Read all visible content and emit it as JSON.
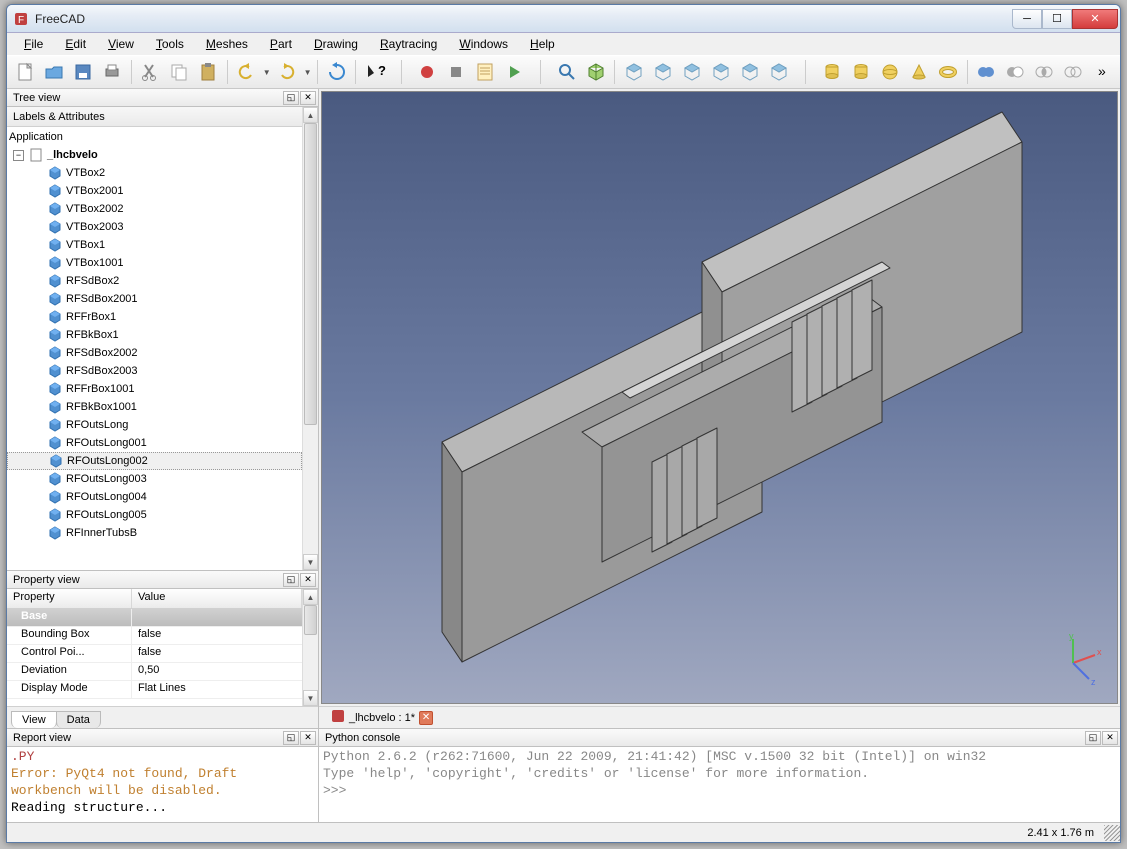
{
  "app_title": "FreeCAD",
  "menubar": [
    "File",
    "Edit",
    "View",
    "Tools",
    "Meshes",
    "Part",
    "Drawing",
    "Raytracing",
    "Windows",
    "Help"
  ],
  "toolbar_icons": [
    "new-doc-icon",
    "open-icon",
    "save-icon",
    "print-icon",
    "sep",
    "cut-icon",
    "copy-icon",
    "paste-icon",
    "sep",
    "undo-icon",
    "dd",
    "redo-icon",
    "dd",
    "sep",
    "refresh-icon",
    "sep",
    "whatsthis-icon",
    "sep2",
    "record-icon",
    "stop-icon",
    "macro-icon",
    "play-icon",
    "sep2",
    "zoom-fit-icon",
    "iso-icon",
    "sep",
    "front-icon",
    "top-icon",
    "right-icon",
    "back-icon",
    "bottom-icon",
    "left-icon",
    "sep2",
    "cylinder-icon",
    "cylinder2-icon",
    "sphere-icon",
    "cone-icon",
    "torus-icon",
    "sep",
    "bool-union-icon",
    "bool-cut-icon",
    "bool-intersect-icon",
    "bool-section-icon",
    "overflow-icon"
  ],
  "tree_panel": {
    "title": "Tree view",
    "subheader": "Labels & Attributes"
  },
  "tree": {
    "root": "Application",
    "doc": "_lhcbvelo",
    "items": [
      "VTBox2",
      "VTBox2001",
      "VTBox2002",
      "VTBox2003",
      "VTBox1",
      "VTBox1001",
      "RFSdBox2",
      "RFSdBox2001",
      "RFFrBox1",
      "RFBkBox1",
      "RFSdBox2002",
      "RFSdBox2003",
      "RFFrBox1001",
      "RFBkBox1001",
      "RFOutsLong",
      "RFOutsLong001",
      "RFOutsLong002",
      "RFOutsLong003",
      "RFOutsLong004",
      "RFOutsLong005",
      "RFInnerTubsB"
    ],
    "selected_index": 16
  },
  "property_panel": {
    "title": "Property view",
    "columns": [
      "Property",
      "Value"
    ],
    "group": "Base",
    "rows": [
      {
        "prop": "Bounding Box",
        "val": "false"
      },
      {
        "prop": "Control Poi...",
        "val": "false"
      },
      {
        "prop": "Deviation",
        "val": "0,50"
      },
      {
        "prop": "Display Mode",
        "val": "Flat Lines"
      }
    ],
    "tabs": [
      "View",
      "Data"
    ],
    "active_tab": 0
  },
  "doc_tab": "_lhcbvelo : 1*",
  "report_panel": {
    "title": "Report view",
    "lines": [
      {
        "cls": "l1",
        "text": ".PY"
      },
      {
        "cls": "l2",
        "text": "Error: PyQt4 not found, Draft"
      },
      {
        "cls": "l2",
        "text": "workbench will be disabled."
      },
      {
        "cls": "l3",
        "text": "Reading structure..."
      }
    ]
  },
  "console_panel": {
    "title": "Python console",
    "lines": [
      "Python 2.6.2 (r262:71600, Jun 22 2009, 21:41:42) [MSC v.1500 32 bit (Intel)] on win32",
      "Type 'help', 'copyright', 'credits' or 'license' for more information.",
      ">>>"
    ]
  },
  "statusbar": {
    "dims": "2.41 x 1.76 m"
  }
}
